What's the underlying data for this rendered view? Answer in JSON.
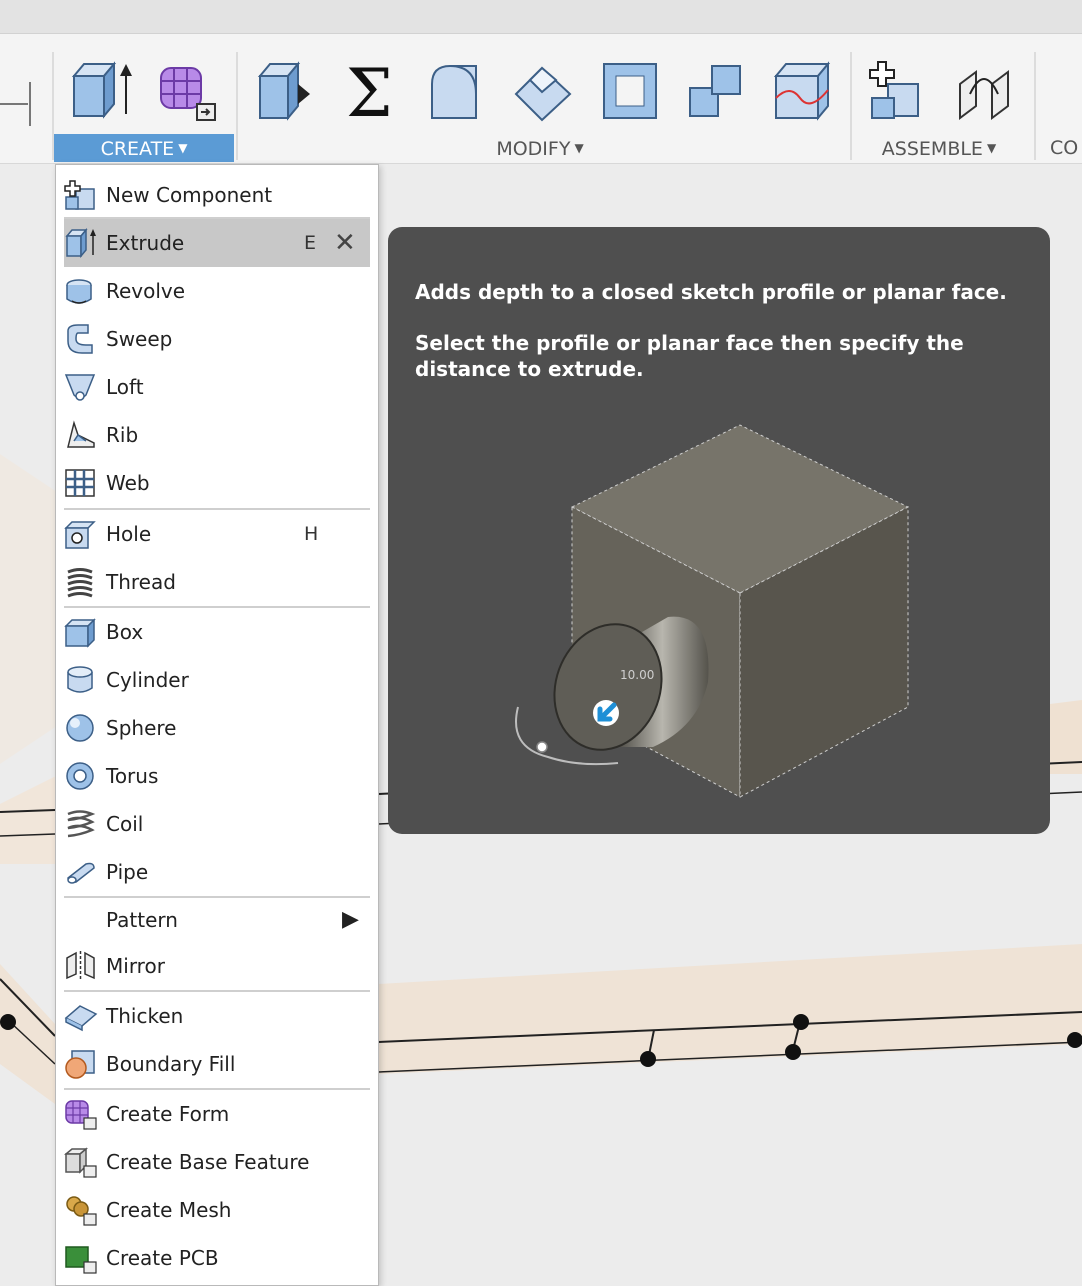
{
  "toolbar": {
    "create_label": "CREATE",
    "modify_label": "MODIFY",
    "assemble_label": "ASSEMBLE",
    "construct_label": "CO",
    "accent_color": "#5b9bd5"
  },
  "menu": {
    "items": [
      {
        "label": "New Component",
        "icon": "new-component-icon"
      },
      {
        "label": "Extrude",
        "shortcut": "E",
        "icon": "extrude-icon"
      },
      {
        "label": "Revolve",
        "icon": "revolve-icon"
      },
      {
        "label": "Sweep",
        "icon": "sweep-icon"
      },
      {
        "label": "Loft",
        "icon": "loft-icon"
      },
      {
        "label": "Rib",
        "icon": "rib-icon"
      },
      {
        "label": "Web",
        "icon": "web-icon"
      },
      {
        "label": "Hole",
        "shortcut": "H",
        "icon": "hole-icon"
      },
      {
        "label": "Thread",
        "icon": "thread-icon"
      },
      {
        "label": "Box",
        "icon": "box-icon"
      },
      {
        "label": "Cylinder",
        "icon": "cylinder-icon"
      },
      {
        "label": "Sphere",
        "icon": "sphere-icon"
      },
      {
        "label": "Torus",
        "icon": "torus-icon"
      },
      {
        "label": "Coil",
        "icon": "coil-icon"
      },
      {
        "label": "Pipe",
        "icon": "pipe-icon"
      },
      {
        "label": "Pattern",
        "icon": "submenu-arrow-icon"
      },
      {
        "label": "Mirror",
        "icon": "mirror-icon"
      },
      {
        "label": "Thicken",
        "icon": "thicken-icon"
      },
      {
        "label": "Boundary Fill",
        "icon": "boundary-fill-icon"
      },
      {
        "label": "Create Form",
        "icon": "create-form-icon"
      },
      {
        "label": "Create Base Feature",
        "icon": "create-base-feature-icon"
      },
      {
        "label": "Create Mesh",
        "icon": "create-mesh-icon"
      },
      {
        "label": "Create PCB",
        "icon": "create-pcb-icon"
      }
    ]
  },
  "tooltip": {
    "line1": "Adds depth to a closed sketch profile or planar face.",
    "line2": "Select the profile or planar face then specify the distance to extrude.",
    "dimension_value": "10.00"
  }
}
